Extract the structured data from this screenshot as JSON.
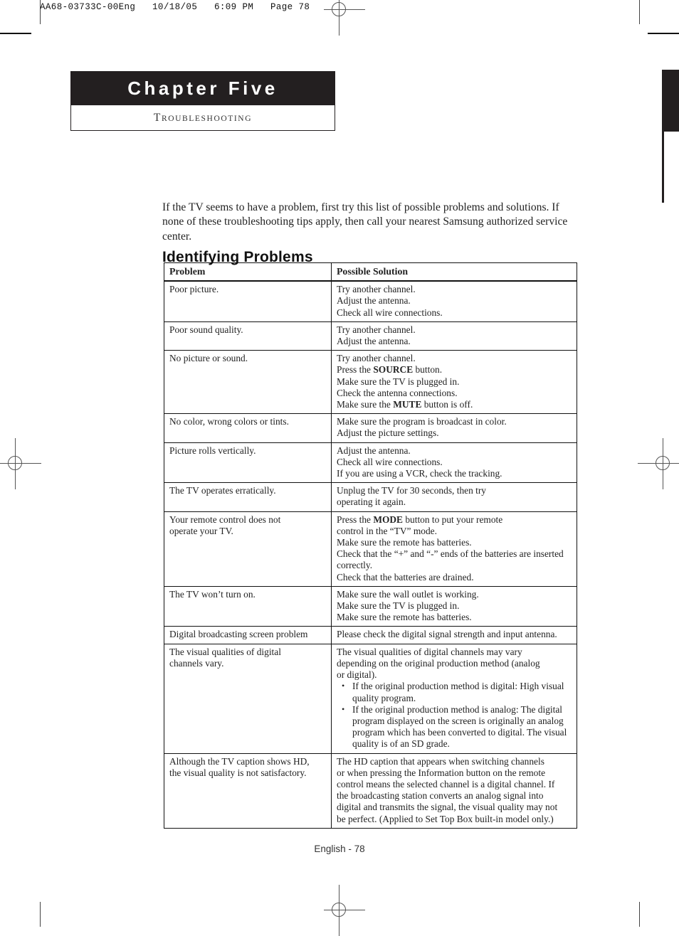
{
  "prepress": {
    "header_line": "AA68-03733C-00Eng   10/18/05   6:09 PM   Page 78"
  },
  "chapter": {
    "title": "Chapter Five",
    "subtitle_first_letter": "T",
    "subtitle_rest": "ROUBLESHOOTING",
    "subtitle_full": "TROUBLESHOOTING"
  },
  "intro": {
    "text": "If the TV seems to have a problem, first try this list of possible problems and solutions. If none of these troubleshooting tips apply, then call your nearest Samsung authorized service center."
  },
  "section": {
    "heading": "Identifying Problems"
  },
  "table": {
    "headers": [
      "Problem",
      "Possible Solution"
    ],
    "rows": [
      {
        "problem": [
          "Poor picture."
        ],
        "solution": [
          "Try another channel.",
          "Adjust the antenna.",
          "Check all wire connections."
        ]
      },
      {
        "problem": [
          "Poor sound quality."
        ],
        "solution": [
          "Try another channel.",
          "Adjust the antenna."
        ]
      },
      {
        "problem": [
          "No picture or sound."
        ],
        "solution_rich": [
          {
            "text": "Try another channel."
          },
          {
            "pre": "Press the ",
            "bold": "SOURCE",
            "post": " button."
          },
          {
            "text": "Make sure the TV is plugged in."
          },
          {
            "text": "Check the antenna connections."
          },
          {
            "pre": "Make sure the ",
            "bold": "MUTE",
            "post": " button is off."
          }
        ]
      },
      {
        "problem": [
          "No color, wrong colors or tints."
        ],
        "solution": [
          "Make sure the program is broadcast in color.",
          "Adjust the picture settings."
        ]
      },
      {
        "problem": [
          "Picture rolls vertically."
        ],
        "solution": [
          "Adjust the antenna.",
          "Check all wire connections.",
          "If you are using a VCR, check the tracking."
        ]
      },
      {
        "problem": [
          "The TV operates erratically."
        ],
        "solution": [
          "Unplug the TV for 30 seconds, then try",
          "operating it again."
        ]
      },
      {
        "problem": [
          "Your remote control does not",
          "operate your TV."
        ],
        "solution_rich": [
          {
            "pre": "Press the ",
            "bold": "MODE",
            "post": " button to put your remote"
          },
          {
            "text": "control in the “TV” mode."
          },
          {
            "text": "Make sure the remote has batteries."
          },
          {
            "text": "Check that the “+” and “-” ends of the batteries are inserted"
          },
          {
            "text": "correctly."
          },
          {
            "text": "Check that the batteries are drained."
          }
        ]
      },
      {
        "problem": [
          "The TV won’t turn on."
        ],
        "solution": [
          "Make sure the wall outlet is working.",
          "Make sure the TV is plugged in.",
          "Make sure the remote has batteries."
        ]
      },
      {
        "problem": [
          "Digital broadcasting screen problem"
        ],
        "solution": [
          "Please check the digital signal strength and input antenna."
        ]
      },
      {
        "problem": [
          "The visual qualities of digital",
          "channels vary."
        ],
        "solution": [
          "The visual qualities of digital channels may vary",
          "depending on the original production method (analog",
          "or digital)."
        ],
        "bullets": [
          "If the original production method is digital: High visual quality program.",
          "If the original production method is analog: The digital program displayed on the screen is originally an analog program which has been converted to digital. The visual quality is of an SD grade."
        ]
      },
      {
        "problem": [
          "Although the TV caption shows HD,",
          "the visual quality is not satisfactory."
        ],
        "solution": [
          "The HD caption that appears when switching channels",
          "or when pressing the Information button on the remote",
          "control means the selected channel is a digital channel. If",
          "the broadcasting station converts an analog signal into",
          "digital and transmits the signal, the visual quality may not",
          "be perfect. (Applied to Set Top Box built-in model only.)"
        ]
      }
    ]
  },
  "footer": {
    "page_label": "English - 78"
  },
  "colors": {
    "chapter_bar": "#231f20",
    "text": "#222222",
    "rule": "#111111"
  }
}
